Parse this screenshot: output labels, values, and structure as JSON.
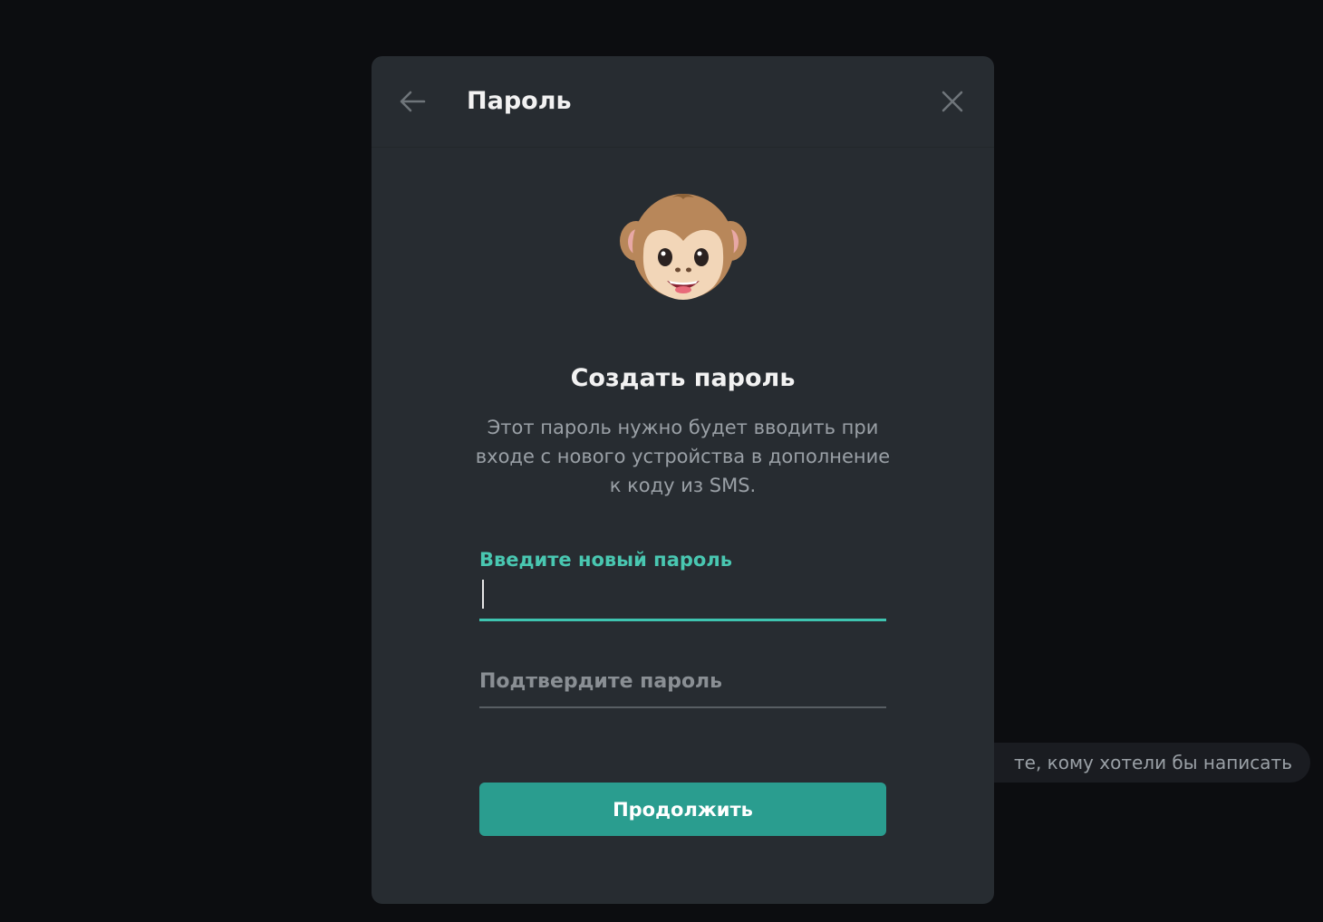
{
  "background": {
    "hint_text": "те, кому хотели бы написать"
  },
  "modal": {
    "title": "Пароль",
    "back_icon": "arrow-left-icon",
    "close_icon": "close-icon",
    "illustration": "monkey-face-icon",
    "headline": "Создать пароль",
    "description": "Этот пароль нужно будет вводить при входе с нового устройства в дополнение к коду из SMS.",
    "new_password": {
      "label": "Введите новый пароль",
      "value": ""
    },
    "confirm_password": {
      "placeholder": "Подтвердите пароль",
      "value": ""
    },
    "continue_label": "Продолжить"
  },
  "colors": {
    "accent": "#49c7b1",
    "button": "#2a9d8f",
    "modal_bg": "#272c31",
    "page_bg": "#0c0d10"
  }
}
